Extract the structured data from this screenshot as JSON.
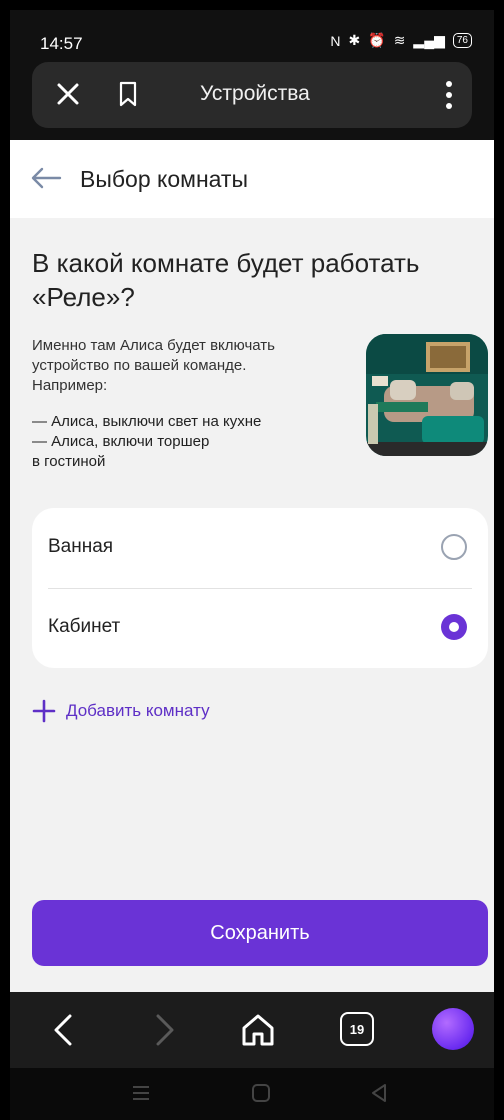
{
  "status_bar": {
    "time": "14:57",
    "battery": "76"
  },
  "browser": {
    "title": "Устройства",
    "tabs_count": "19"
  },
  "header": {
    "title": "Выбор комнаты"
  },
  "question": "В какой комнате будет работать «Реле»?",
  "description": [
    "Именно там Алиса будет включать",
    "устройство по вашей команде.",
    "Например:"
  ],
  "examples": [
    "— Алиса, выключи свет на кухне",
    "— Алиса, включи торшер",
    "в гостиной"
  ],
  "rooms": [
    {
      "name": "Ванная",
      "selected": false
    },
    {
      "name": "Кабинет",
      "selected": true
    }
  ],
  "add_room_label": "Добавить комнату",
  "save_label": "Сохранить",
  "colors": {
    "accent": "#6a33d6",
    "link": "#5e2fc6",
    "background": "#f2f2f2"
  }
}
